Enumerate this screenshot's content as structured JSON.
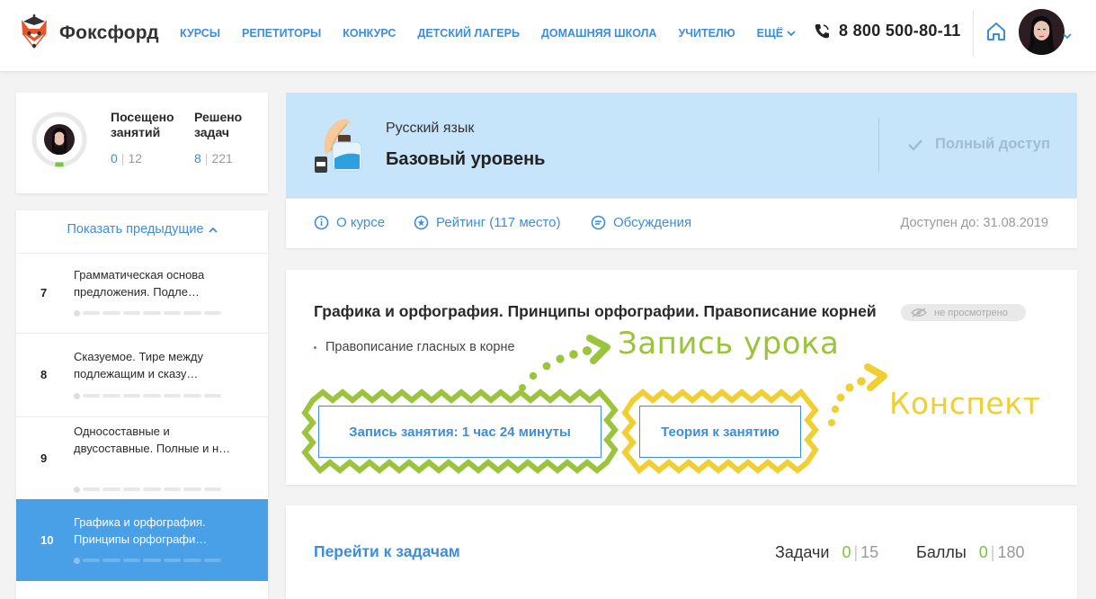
{
  "header": {
    "logo_text": "Фоксфорд",
    "nav": [
      "КУРСЫ",
      "РЕПЕТИТОРЫ",
      "КОНКУРС",
      "ДЕТСКИЙ ЛАГЕРЬ",
      "ДОМАШНЯЯ ШКОЛА",
      "УЧИТЕЛЮ"
    ],
    "nav_more": "ЕЩЁ",
    "phone": "8 800 500-80-11"
  },
  "stats": {
    "visited_label": "Посещено занятий",
    "visited_value": "0",
    "visited_total": "12",
    "solved_label": "Решено задач",
    "solved_value": "8",
    "solved_total": "221"
  },
  "lessons": {
    "show_previous": "Показать предыдущие",
    "items": [
      {
        "num": "7",
        "title": "Грамматическая основа предложения. Подле…"
      },
      {
        "num": "8",
        "title": "Сказуемое. Тире между подлежащим и сказу…"
      },
      {
        "num": "9",
        "title": "Односоставные и двусоставные. Полные и н…"
      },
      {
        "num": "10",
        "title": "Графика и орфография. Принципы орфографи…"
      }
    ]
  },
  "course": {
    "subject": "Русский язык",
    "level": "Базовый уровень",
    "full_access": "Полный доступ",
    "tabs": {
      "about": "О курсе",
      "rating": "Рейтинг (117 место)",
      "discussions": "Обсуждения"
    },
    "available_until": "Доступен до: 31.08.2019"
  },
  "lesson_card": {
    "title": "Графика и орфография. Принципы орфографии. Правописание корней",
    "status_badge": "не просмотрено",
    "topic": "Правописание гласных в корне",
    "recording_button": "Запись занятия: 1 час 24 минуты",
    "theory_button": "Теория к занятию",
    "annotation_recording": "Запись урока",
    "annotation_notes": "Конспект"
  },
  "tasks": {
    "goto": "Перейти к задачам",
    "tasks_label": "Задачи",
    "tasks_value": "0",
    "tasks_total": "15",
    "points_label": "Баллы",
    "points_value": "0",
    "points_total": "180"
  },
  "colors": {
    "accent": "#3f8dd6",
    "active_lesson": "#4aa0e6",
    "course_header_bg": "#c6e4fa",
    "annotation_green": "#9cc33c",
    "annotation_yellow": "#f0cf33",
    "success_green": "#7cc243"
  }
}
